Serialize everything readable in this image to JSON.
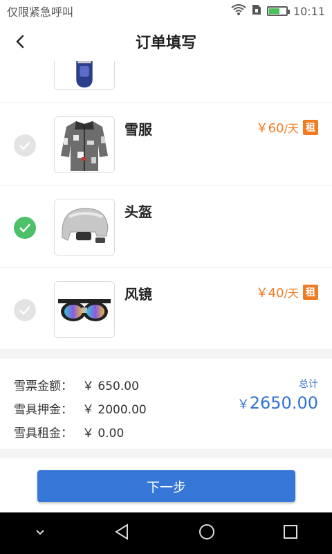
{
  "status_bar": {
    "carrier_text": "仅限紧急呼叫",
    "time": "10:11",
    "icons": [
      "wifi-icon",
      "sim-icon",
      "battery-icon"
    ]
  },
  "header": {
    "title": "订单填写",
    "back_icon": "chevron-left-icon"
  },
  "items": [
    {
      "name": "",
      "checked": true,
      "price": "",
      "price_unit": "",
      "badge": "",
      "image": "snowboard"
    },
    {
      "name": "雪服",
      "checked": false,
      "price": "￥60",
      "price_unit": "/天",
      "badge": "租",
      "image": "ski-jacket"
    },
    {
      "name": "头盔",
      "checked": true,
      "price": "",
      "price_unit": "",
      "badge": "",
      "image": "helmet"
    },
    {
      "name": "风镜",
      "checked": false,
      "price": "￥40",
      "price_unit": "/天",
      "badge": "租",
      "image": "goggles"
    }
  ],
  "summary": {
    "rows": [
      {
        "label": "雪票金额：",
        "value": "￥ 650.00"
      },
      {
        "label": "雪具押金：",
        "value": "￥ 2000.00"
      },
      {
        "label": "雪具租金：",
        "value": "￥ 0.00"
      }
    ],
    "total_label": "总计",
    "total_currency": "￥",
    "total_value": "2650.00"
  },
  "next_button": {
    "label": "下一步"
  },
  "nav_bar": {
    "icons": [
      "down-chevron-icon",
      "back-triangle-icon",
      "home-circle-icon",
      "recents-square-icon"
    ]
  },
  "colors": {
    "accent_blue": "#3576d6",
    "price_orange": "#f07b23",
    "check_green": "#4cc167",
    "check_gray": "#e3e3e3"
  }
}
